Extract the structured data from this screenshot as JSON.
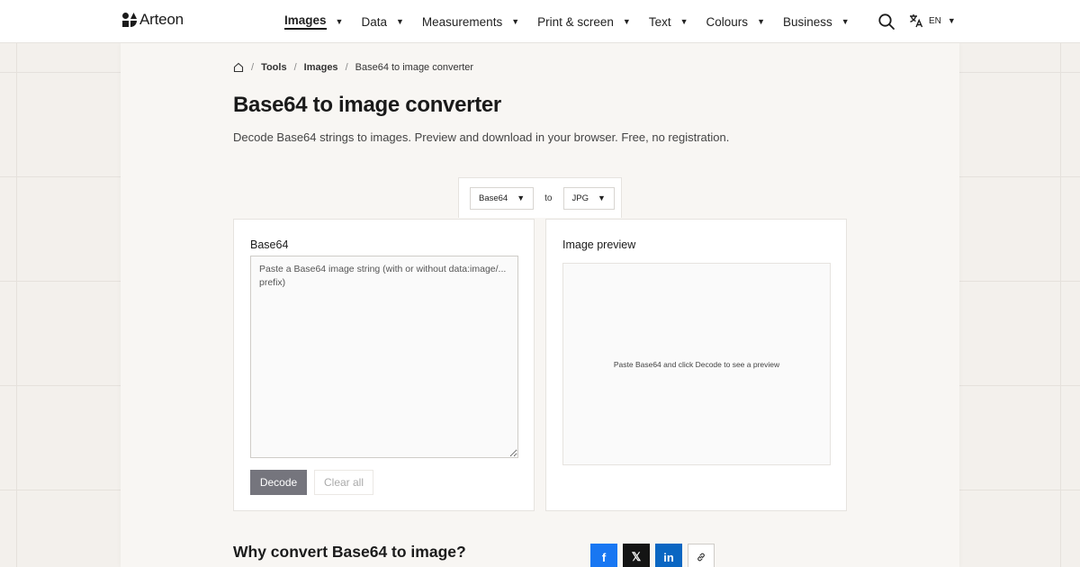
{
  "brand": {
    "name": "Arteon"
  },
  "nav": {
    "items": [
      {
        "label": "Images",
        "active": true
      },
      {
        "label": "Data"
      },
      {
        "label": "Measurements"
      },
      {
        "label": "Print & screen"
      },
      {
        "label": "Text"
      },
      {
        "label": "Colours"
      },
      {
        "label": "Business"
      }
    ],
    "language": "EN"
  },
  "breadcrumb": {
    "items": [
      "Tools",
      "Images",
      "Base64 to image converter"
    ]
  },
  "page": {
    "title": "Base64 to image converter",
    "subtitle": "Decode Base64 strings to images. Preview and download in your browser. Free, no registration."
  },
  "converter": {
    "from": "Base64",
    "to_label": "to",
    "to": "JPG"
  },
  "input_card": {
    "label": "Base64",
    "placeholder": "Paste a Base64 image string (with or without data:image/... prefix)",
    "decode_label": "Decode",
    "clear_label": "Clear all"
  },
  "preview_card": {
    "label": "Image preview",
    "empty_text": "Paste Base64 and click Decode to see a preview"
  },
  "why_section": {
    "title": "Why convert Base64 to image?"
  },
  "share": {
    "facebook": "f",
    "x": "𝕏",
    "linkedin": "in"
  },
  "colors": {
    "accent": "#75757d",
    "facebook": "#1877f2",
    "x": "#141414",
    "linkedin": "#0a66c2"
  }
}
